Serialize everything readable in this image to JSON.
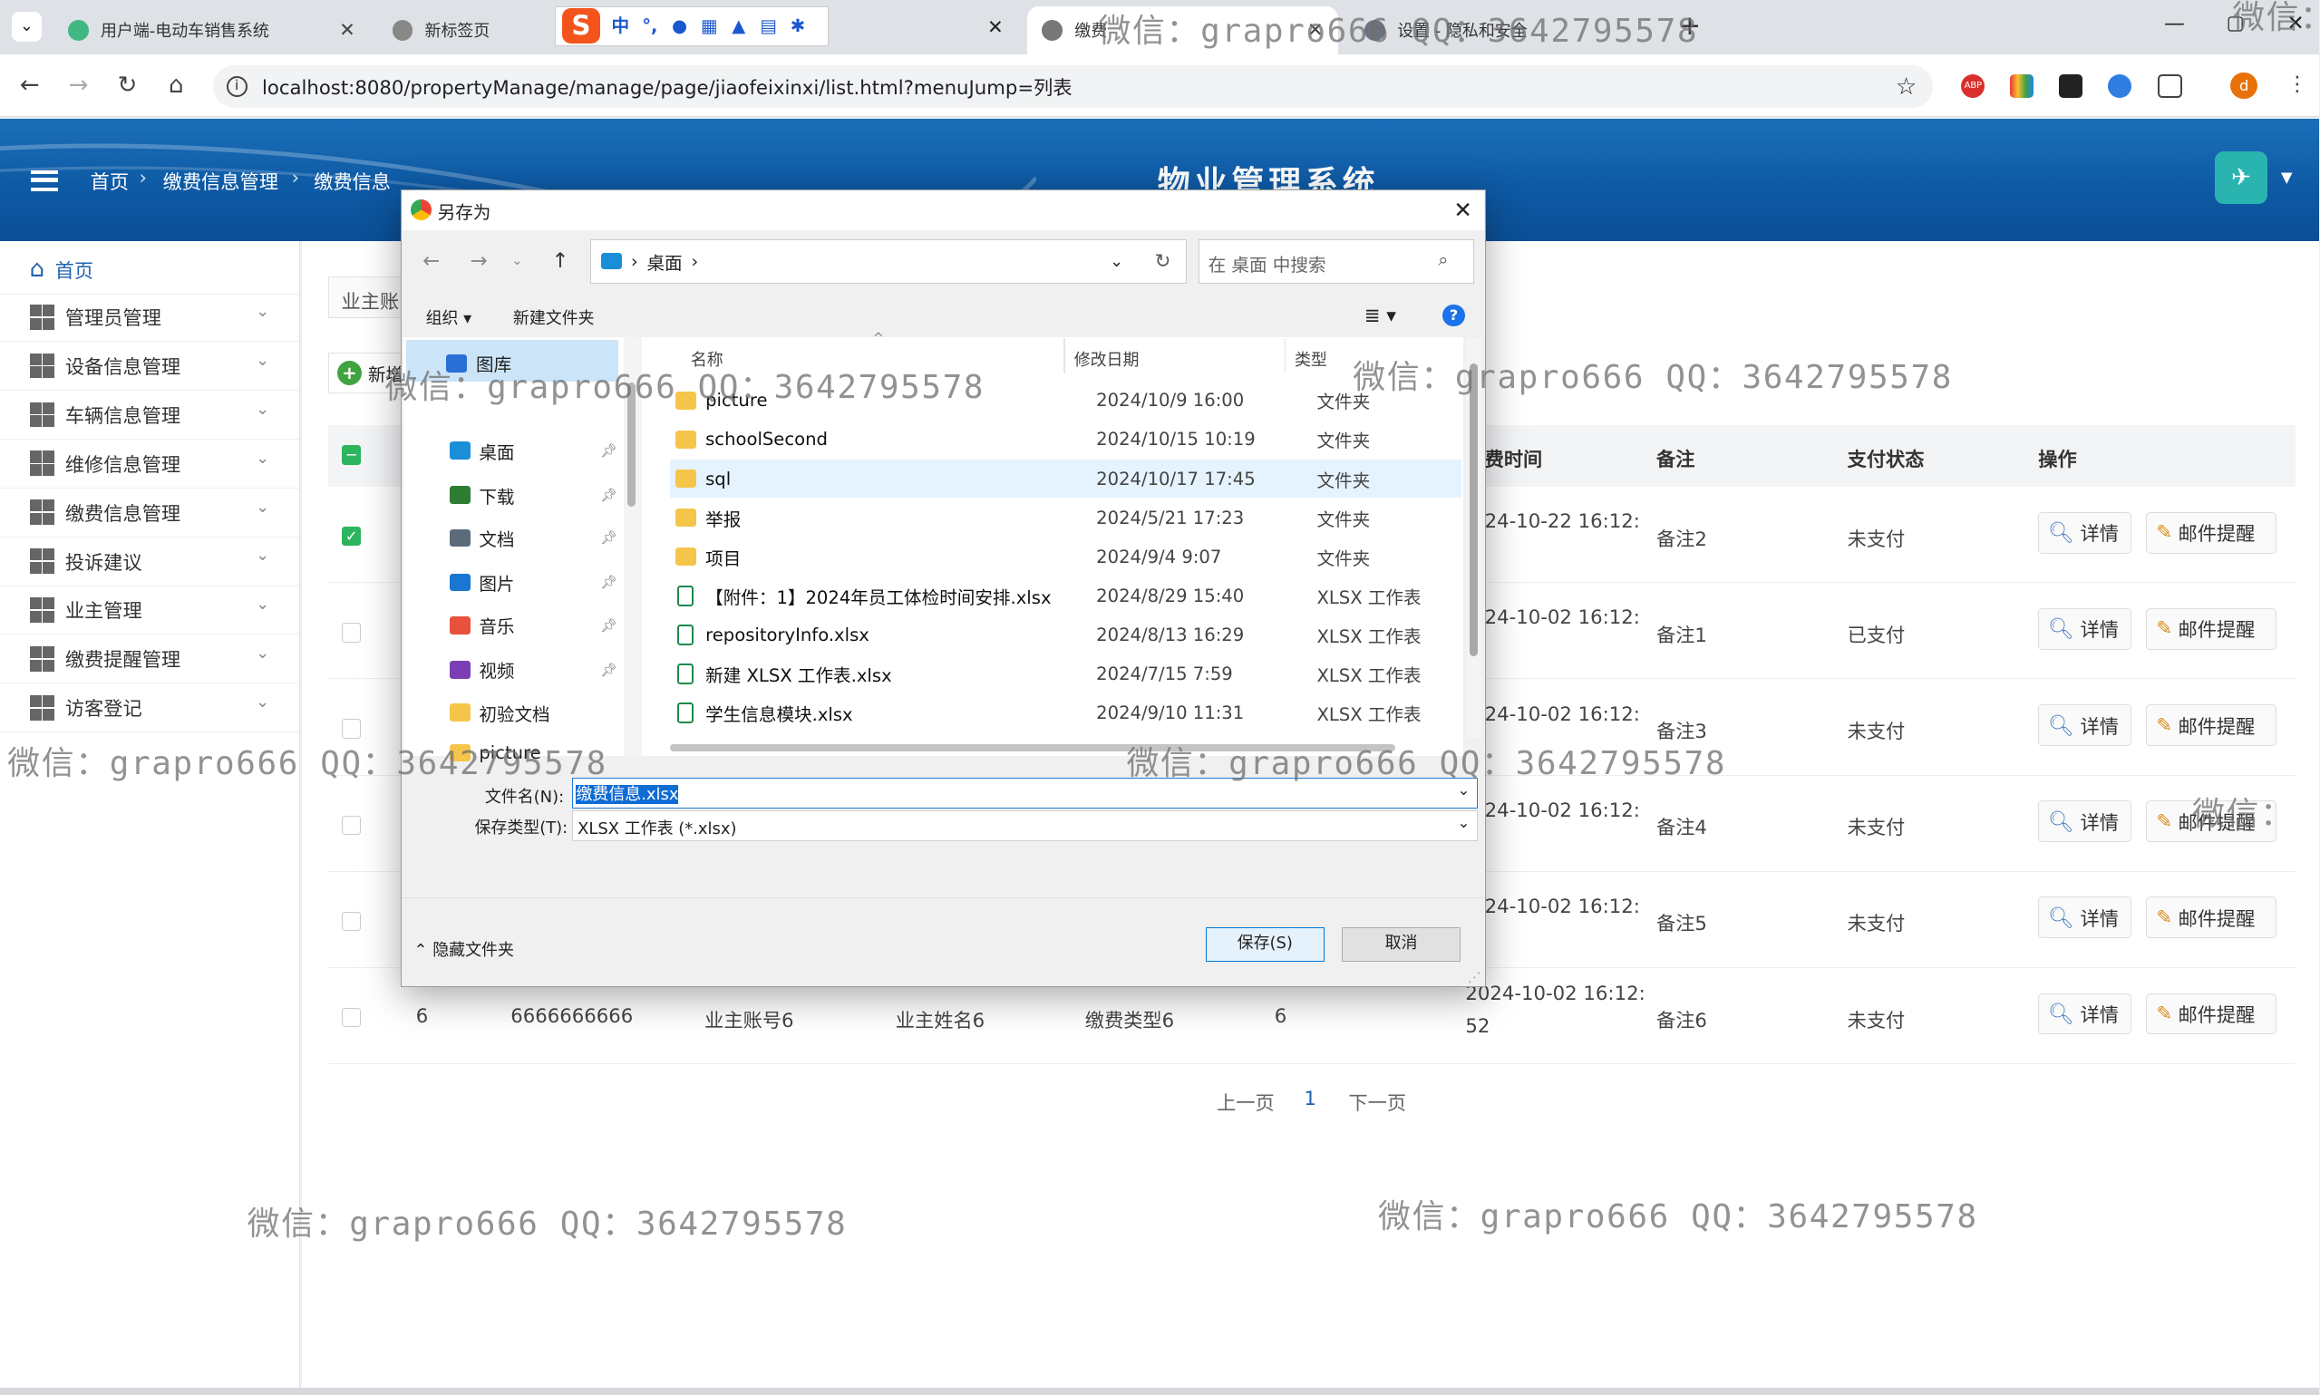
{
  "browser": {
    "tabs": [
      {
        "label": "用户端-电动车销售系统"
      },
      {
        "label": "新标签页"
      },
      {
        "label": "缴费"
      },
      {
        "label": "设置 - 隐私和安全"
      }
    ],
    "ime_logo": "S",
    "ime_label": "中",
    "url": "localhost:8080/propertyManage/manage/page/jiaofeixinxi/list.html?menuJump=列表",
    "profile_initial": "d",
    "ext_abp": "ABP"
  },
  "app": {
    "title": "物业管理系统",
    "breadcrumb": [
      "首页",
      "缴费信息管理",
      "缴费信息"
    ],
    "accent": "#0e5aa5"
  },
  "sidebar": {
    "home": "首页",
    "items": [
      "管理员管理",
      "设备信息管理",
      "车辆信息管理",
      "维修信息管理",
      "缴费信息管理",
      "投诉建议",
      "业主管理",
      "缴费提醒管理",
      "访客登记"
    ]
  },
  "toolbar": {
    "search_label": "业主账",
    "add_label": "新增"
  },
  "table": {
    "headers": {
      "time": "费时间",
      "remark": "备注",
      "pay_status": "支付状态",
      "ops": "操作"
    },
    "rows": [
      {
        "time": "24-10-22 16:12:",
        "remark": "备注2",
        "status": "未支付",
        "checked": true
      },
      {
        "time": "24-10-02 16:12:",
        "remark": "备注1",
        "status": "已支付",
        "checked": false
      },
      {
        "time": "24-10-02 16:12:",
        "remark": "备注3",
        "status": "未支付",
        "checked": false
      },
      {
        "time": "24-10-02 16:12:",
        "remark": "备注4",
        "status": "未支付",
        "checked": false
      },
      {
        "time": "24-10-02 16:12:",
        "remark": "备注5",
        "status": "未支付",
        "checked": false
      },
      {
        "idx": "6",
        "code": "6666666666",
        "account": "业主账号6",
        "name": "业主姓名6",
        "type": "缴费类型6",
        "amount": "6",
        "time": "2024-10-02 16:12:",
        "time2": "52",
        "remark": "备注6",
        "status": "未支付",
        "checked": false
      }
    ],
    "btn_detail": "详情",
    "btn_email": "邮件提醒"
  },
  "pager": {
    "prev": "上一页",
    "current": "1",
    "next": "下一页"
  },
  "dialog": {
    "title": "另存为",
    "path": "桌面",
    "search_placeholder": "在 桌面 中搜索",
    "organize": "组织",
    "new_folder": "新建文件夹",
    "nav": [
      {
        "label": "图库"
      },
      {
        "label": "桌面"
      },
      {
        "label": "下载"
      },
      {
        "label": "文档"
      },
      {
        "label": "图片"
      },
      {
        "label": "音乐"
      },
      {
        "label": "视频"
      },
      {
        "label": "初验文档"
      },
      {
        "label": "picture"
      }
    ],
    "cols": {
      "name": "名称",
      "date": "修改日期",
      "type": "类型"
    },
    "files": [
      {
        "name": "picture",
        "date": "2024/10/9 16:00",
        "type": "文件夹",
        "kind": "folder"
      },
      {
        "name": "schoolSecond",
        "date": "2024/10/15 10:19",
        "type": "文件夹",
        "kind": "folder"
      },
      {
        "name": "sql",
        "date": "2024/10/17 17:45",
        "type": "文件夹",
        "kind": "folder"
      },
      {
        "name": "举报",
        "date": "2024/5/21 17:23",
        "type": "文件夹",
        "kind": "folder"
      },
      {
        "name": "项目",
        "date": "2024/9/4 9:07",
        "type": "文件夹",
        "kind": "folder"
      },
      {
        "name": "【附件：1】2024年员工体检时间安排.xlsx",
        "date": "2024/8/29 15:40",
        "type": "XLSX 工作表",
        "kind": "xlsx"
      },
      {
        "name": "repositoryInfo.xlsx",
        "date": "2024/8/13 16:29",
        "type": "XLSX 工作表",
        "kind": "xlsx"
      },
      {
        "name": "新建 XLSX 工作表.xlsx",
        "date": "2024/7/15 7:59",
        "type": "XLSX 工作表",
        "kind": "xlsx"
      },
      {
        "name": "学生信息模块.xlsx",
        "date": "2024/9/10 11:31",
        "type": "XLSX 工作表",
        "kind": "xlsx"
      }
    ],
    "filename_label": "文件名(N):",
    "filename_value": "缴费信息.xlsx",
    "filetype_label": "保存类型(T):",
    "filetype_value": "XLSX 工作表 (*.xlsx)",
    "hide_folders": "隐藏文件夹",
    "save": "保存(S)",
    "cancel": "取消"
  },
  "watermarks": [
    "微信：grapro666 QQ：3642795578",
    "微信："
  ]
}
